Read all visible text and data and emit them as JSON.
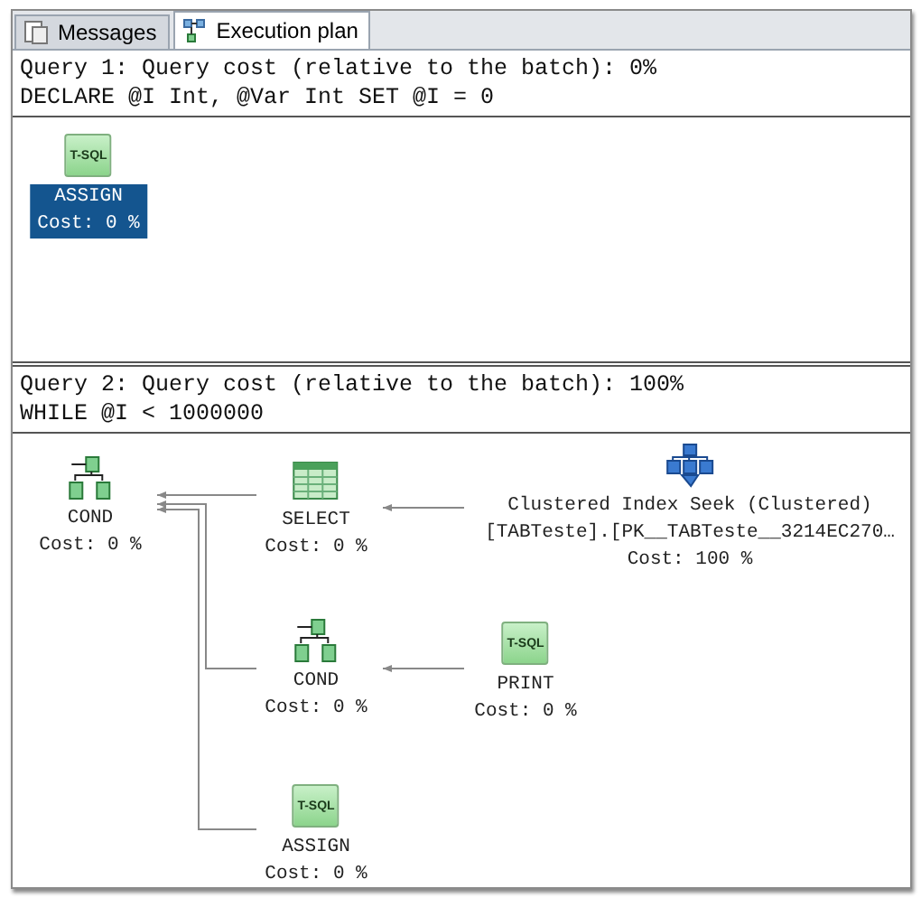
{
  "tabs": [
    {
      "label": "Messages",
      "selected": false
    },
    {
      "label": "Execution plan",
      "selected": true
    }
  ],
  "queries": [
    {
      "header": "Query 1: Query cost (relative to the batch): 0%",
      "statement": "DECLARE @I Int, @Var Int SET @I = 0",
      "nodes": [
        {
          "kind": "tsql",
          "badge": "T-SQL",
          "name": "ASSIGN",
          "cost": "Cost: 0 %",
          "selected": true
        }
      ]
    },
    {
      "header": "Query 2: Query cost (relative to the batch): 100%",
      "statement": "WHILE @I < 1000000",
      "nodes": [
        {
          "kind": "cond",
          "name": "COND",
          "cost": "Cost: 0 %",
          "selected": false
        },
        {
          "kind": "select",
          "name": "SELECT",
          "cost": "Cost: 0 %",
          "selected": false
        },
        {
          "kind": "seek",
          "name": "Clustered Index Seek (Clustered)",
          "detail": "[TABTeste].[PK__TABTeste__3214EC270…",
          "cost": "Cost: 100 %",
          "selected": false
        },
        {
          "kind": "cond",
          "name": "COND",
          "cost": "Cost: 0 %",
          "selected": false
        },
        {
          "kind": "tsql",
          "badge": "T-SQL",
          "name": "PRINT",
          "cost": "Cost: 0 %",
          "selected": false
        },
        {
          "kind": "tsql",
          "badge": "T-SQL",
          "name": "ASSIGN",
          "cost": "Cost: 0 %",
          "selected": false
        }
      ]
    }
  ]
}
